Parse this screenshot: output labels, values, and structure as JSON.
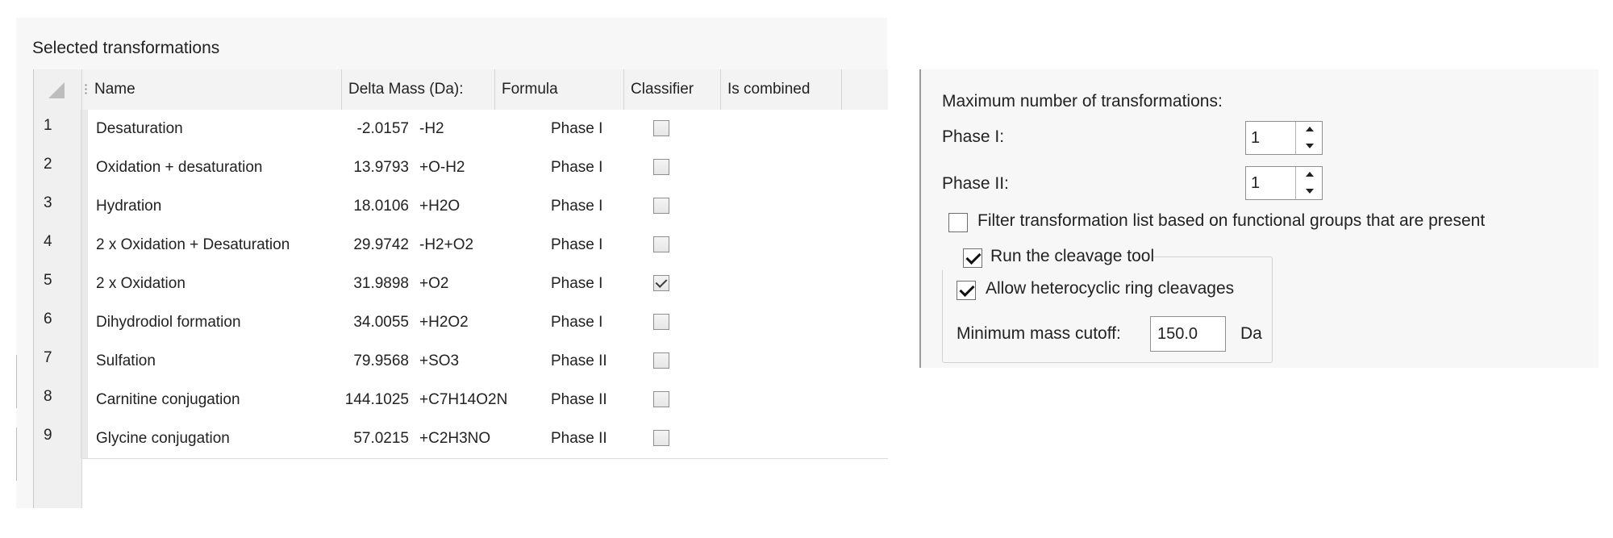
{
  "transformations": {
    "title": "Selected transformations",
    "columns": [
      "Name",
      "Delta Mass (Da):",
      "Formula",
      "Classifier",
      "Is combined"
    ],
    "rows": [
      {
        "n": "1",
        "name": "Desaturation",
        "mass": "-2.0157",
        "formula": "-H2",
        "classifier": "Phase I",
        "combined": false
      },
      {
        "n": "2",
        "name": "Oxidation + desaturation",
        "mass": "13.9793",
        "formula": "+O-H2",
        "classifier": "Phase I",
        "combined": false
      },
      {
        "n": "3",
        "name": "Hydration",
        "mass": "18.0106",
        "formula": "+H2O",
        "classifier": "Phase I",
        "combined": false
      },
      {
        "n": "4",
        "name": "2 x Oxidation + Desaturation",
        "mass": "29.9742",
        "formula": "-H2+O2",
        "classifier": "Phase I",
        "combined": false
      },
      {
        "n": "5",
        "name": "2 x Oxidation",
        "mass": "31.9898",
        "formula": "+O2",
        "classifier": "Phase I",
        "combined": true
      },
      {
        "n": "6",
        "name": "Dihydrodiol formation",
        "mass": "34.0055",
        "formula": "+H2O2",
        "classifier": "Phase I",
        "combined": false
      },
      {
        "n": "7",
        "name": "Sulfation",
        "mass": "79.9568",
        "formula": "+SO3",
        "classifier": "Phase II",
        "combined": false
      },
      {
        "n": "8",
        "name": "Carnitine conjugation",
        "mass": "144.1025",
        "formula": "+C7H14O2N",
        "classifier": "Phase II",
        "combined": false
      },
      {
        "n": "9",
        "name": "Glycine conjugation",
        "mass": "57.0215",
        "formula": "+C2H3NO",
        "classifier": "Phase II",
        "combined": false
      }
    ]
  },
  "settings": {
    "max_label": "Maximum number of transformations:",
    "phase1_label": "Phase I:",
    "phase1_value": "1",
    "phase2_label": "Phase II:",
    "phase2_value": "1",
    "filter_label": "Filter transformation list based on functional groups that are present",
    "filter_checked": false,
    "cleavage_label": "Run the cleavage tool",
    "cleavage_checked": true,
    "hetero_label": "Allow heterocyclic ring cleavages",
    "hetero_checked": true,
    "cutoff_label": "Minimum mass cutoff:",
    "cutoff_value": "150.0",
    "cutoff_unit": "Da"
  }
}
